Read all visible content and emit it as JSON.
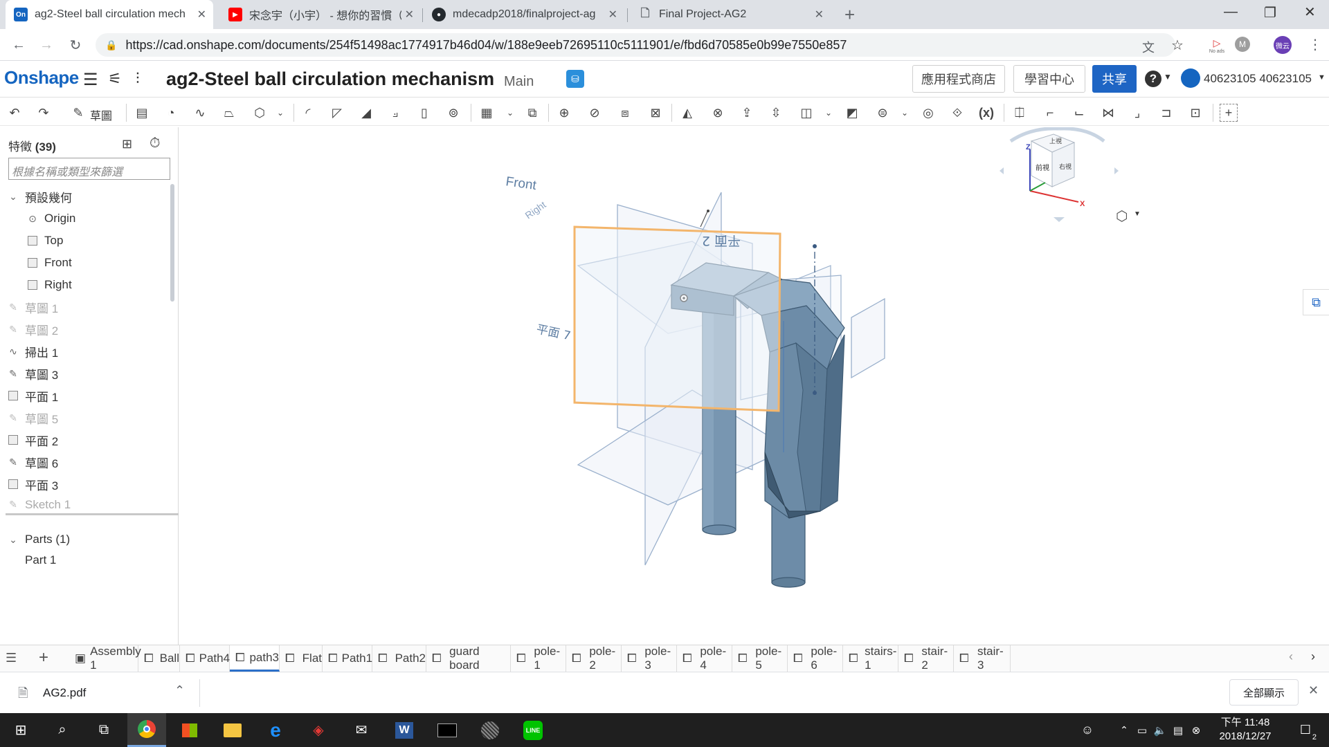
{
  "browser": {
    "tabs": [
      {
        "title": "ag2-Steel ball circulation mech",
        "icon": "onshape-favicon",
        "active": true
      },
      {
        "title": "宋念宇（小宇） - 想你的習慣（",
        "icon": "youtube-favicon",
        "active": false
      },
      {
        "title": "mdecadp2018/finalproject-ag",
        "icon": "github-favicon",
        "active": false
      },
      {
        "title": "Final Project-AG2",
        "icon": "document-favicon",
        "active": false
      }
    ],
    "new_tab": "+",
    "url": "https://cad.onshape.com/documents/254f51498ac1774917b46d04/w/188e9eeb72695110c5111901/e/fbd6d70585e0b99e7550e857",
    "no_ads_label": "No ads",
    "profile_label": "微云"
  },
  "header": {
    "logo": "Onshape",
    "doc_title": "ag2-Steel ball circulation mechanism",
    "branch": "Main",
    "app_store": "應用程式商店",
    "learning": "學習中心",
    "share": "共享",
    "help": "?",
    "user": "40623105 40623105"
  },
  "toolbar": {
    "sketch_label": "草圖",
    "variable_label": "(x)"
  },
  "features": {
    "header": "特徵",
    "count": "(39)",
    "filter_placeholder": "根據名稱或類型來篩選",
    "default_geometry": "預設幾何",
    "origin": "Origin",
    "top": "Top",
    "front": "Front",
    "right": "Right",
    "items": [
      "草圖 1",
      "草圖 2",
      "掃出 1",
      "草圖 3",
      "平面 1",
      "草圖 5",
      "平面 2",
      "草圖 6",
      "平面 3",
      "Sketch 1"
    ],
    "parts_header": "Parts (1)",
    "part1": "Part 1"
  },
  "viewport": {
    "plane_front": "Front",
    "plane_right": "Right",
    "plane_2": "平面 2",
    "plane_7": "平面 7",
    "viewcube_top": "上視",
    "viewcube_front": "前視",
    "viewcube_right": "右視",
    "axis_x": "X",
    "axis_z": "Z"
  },
  "bottom_tabs": [
    "Assembly 1",
    "Ball",
    "Path4",
    "path3",
    "Flat",
    "Path1",
    "Path2",
    "guard board",
    "pole-1",
    "pole-2",
    "pole-3",
    "pole-4",
    "pole-5",
    "pole-6",
    "stairs-1",
    "stair-2",
    "stair-3"
  ],
  "download": {
    "file": "AG2.pdf",
    "show_all": "全部顯示"
  },
  "taskbar": {
    "time": "下午 11:48",
    "date": "2018/12/27",
    "notif_count": "2"
  },
  "colors": {
    "onshape_blue": "#1565c0",
    "share_blue": "#1e65c4",
    "part_steel": "#6d8ca8",
    "selected_plane": "#f3b56b"
  }
}
